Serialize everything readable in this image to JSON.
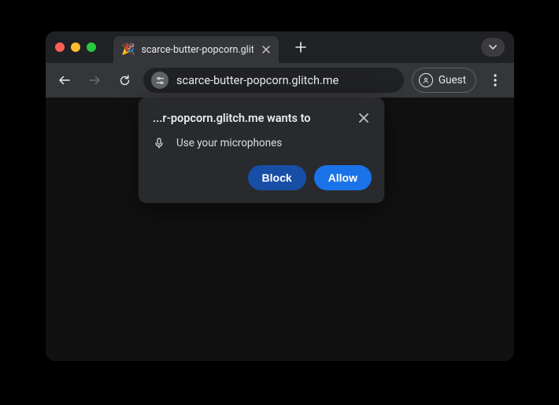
{
  "tab": {
    "favicon": "🎉",
    "title": "scarce-butter-popcorn.glitch"
  },
  "address": {
    "url_text": "scarce-butter-popcorn.glitch.me"
  },
  "profile": {
    "label": "Guest"
  },
  "permission_prompt": {
    "title": "...r-popcorn.glitch.me wants to",
    "item_label": "Use your microphones",
    "block_label": "Block",
    "allow_label": "Allow"
  }
}
